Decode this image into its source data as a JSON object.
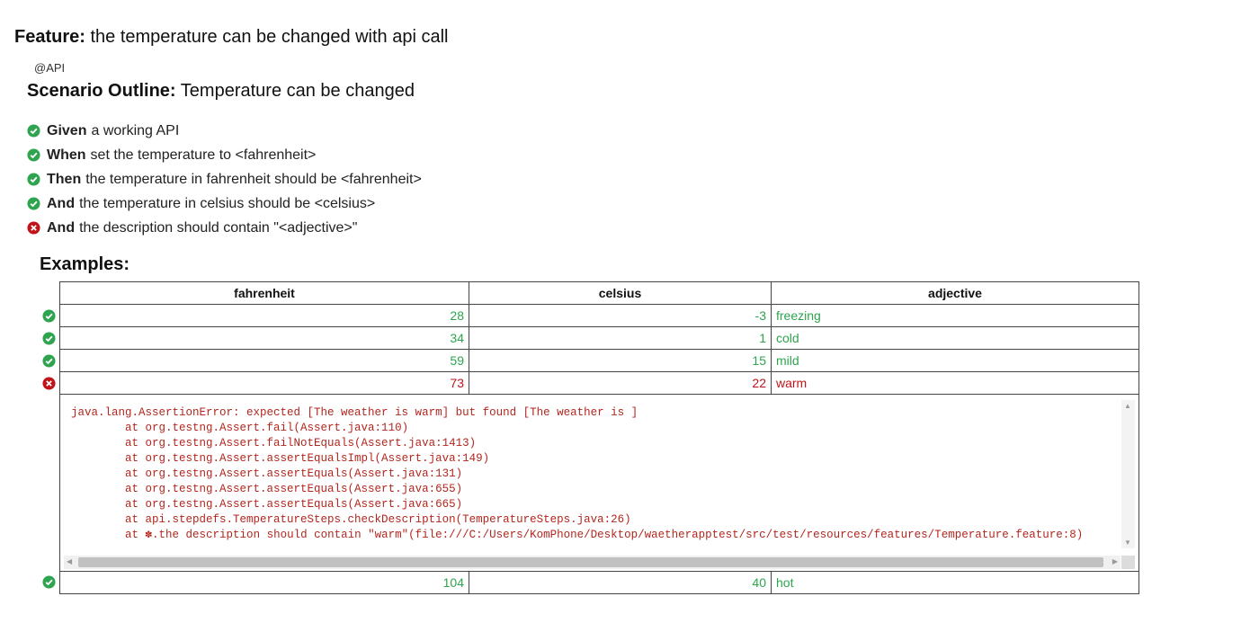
{
  "feature": {
    "keyword": "Feature:",
    "title": "the temperature can be changed with api call"
  },
  "tag": "@API",
  "scenario": {
    "keyword": "Scenario Outline:",
    "title": "Temperature can be changed"
  },
  "steps": [
    {
      "keyword": "Given",
      "text": "a working API",
      "status": "passed"
    },
    {
      "keyword": "When",
      "text": "set the temperature to <fahrenheit>",
      "status": "passed"
    },
    {
      "keyword": "Then",
      "text": "the temperature in fahrenheit should be <fahrenheit>",
      "status": "passed"
    },
    {
      "keyword": "And",
      "text": "the temperature in celsius should be <celsius>",
      "status": "passed"
    },
    {
      "keyword": "And",
      "text": "the description should contain \"<adjective>\"",
      "status": "failed"
    }
  ],
  "examples": {
    "title": "Examples:",
    "headers": [
      "fahrenheit",
      "celsius",
      "adjective"
    ],
    "rows": [
      {
        "fahrenheit": "28",
        "celsius": "-3",
        "adjective": "freezing",
        "status": "passed"
      },
      {
        "fahrenheit": "34",
        "celsius": "1",
        "adjective": "cold",
        "status": "passed"
      },
      {
        "fahrenheit": "59",
        "celsius": "15",
        "adjective": "mild",
        "status": "passed"
      },
      {
        "fahrenheit": "73",
        "celsius": "22",
        "adjective": "warm",
        "status": "failed"
      },
      {
        "fahrenheit": "104",
        "celsius": "40",
        "adjective": "hot",
        "status": "passed"
      }
    ],
    "error": "java.lang.AssertionError: expected [The weather is warm] but found [The weather is ]\n\tat org.testng.Assert.fail(Assert.java:110)\n\tat org.testng.Assert.failNotEquals(Assert.java:1413)\n\tat org.testng.Assert.assertEqualsImpl(Assert.java:149)\n\tat org.testng.Assert.assertEquals(Assert.java:131)\n\tat org.testng.Assert.assertEquals(Assert.java:655)\n\tat org.testng.Assert.assertEquals(Assert.java:665)\n\tat api.stepdefs.TemperatureSteps.checkDescription(TemperatureSteps.java:26)\n\tat ✽.the description should contain \"warm\"(file:///C:/Users/KomPhone/Desktop/waetherapptest/src/test/resources/features/Temperature.feature:8)"
  },
  "colors": {
    "passed": "#2ea44f",
    "failed": "#c0141a"
  },
  "icons": {
    "passed": "check-circle-icon",
    "failed": "x-circle-icon"
  }
}
